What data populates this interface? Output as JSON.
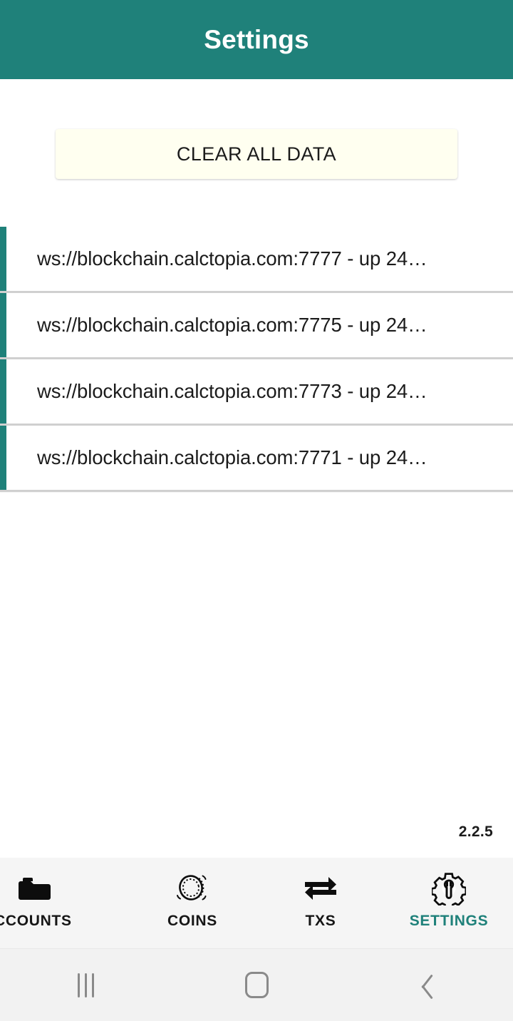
{
  "appbar": {
    "title": "Settings"
  },
  "actions": {
    "clear_all_data_label": "CLEAR ALL DATA"
  },
  "nodes": [
    {
      "label": "ws://blockchain.calctopia.com:7777 - up 24…"
    },
    {
      "label": "ws://blockchain.calctopia.com:7775 - up 24…"
    },
    {
      "label": "ws://blockchain.calctopia.com:7773 - up 24…"
    },
    {
      "label": "ws://blockchain.calctopia.com:7771 - up 24…"
    }
  ],
  "footer": {
    "version": "2.2.5"
  },
  "tabbar": {
    "items": [
      {
        "label": "CCOUNTS",
        "icon": "folder-icon",
        "active": false
      },
      {
        "label": "COINS",
        "icon": "coin-icon",
        "active": false
      },
      {
        "label": "TXS",
        "icon": "swap-arrows-icon",
        "active": false
      },
      {
        "label": "SETTINGS",
        "icon": "gear-wrench-icon",
        "active": true
      }
    ]
  },
  "system_nav": {
    "recents_label": "recents",
    "home_label": "home",
    "back_label": "back"
  },
  "colors": {
    "accent_teal": "#1f817a",
    "button_ivory": "#fffff0",
    "tabbar_bg": "#f5f5f5",
    "sysnav_bg": "#f2f2f2"
  }
}
